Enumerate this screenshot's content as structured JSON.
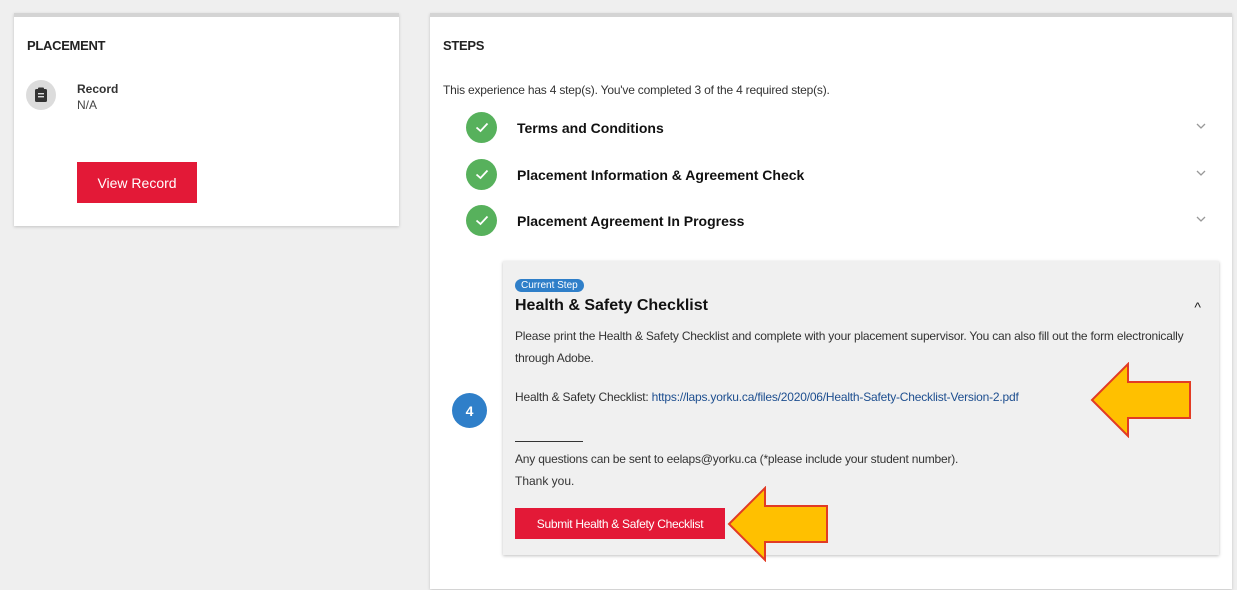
{
  "placement": {
    "title": "PLACEMENT",
    "record_label": "Record",
    "record_value": "N/A",
    "view_record_button": "View Record"
  },
  "steps": {
    "title": "STEPS",
    "summary": "This experience has 4 step(s). You've completed 3 of the 4 required step(s).",
    "completed": [
      {
        "label": "Terms and Conditions"
      },
      {
        "label": "Placement Information & Agreement Check"
      },
      {
        "label": "Placement Agreement In Progress"
      }
    ],
    "current": {
      "number": "4",
      "badge": "Current Step",
      "title": "Health & Safety Checklist",
      "caret": "^",
      "description": "Please print the Health & Safety Checklist and complete with your placement supervisor. You can also fill out the form electronically through Adobe.",
      "link_prefix": "Health & Safety Checklist: ",
      "link_text": "https://laps.yorku.ca/files/2020/06/Health-Safety-Checklist-Version-2.pdf",
      "questions": "Any questions can be sent to eelaps@yorku.ca (*please include your student number).",
      "thanks": "Thank you.",
      "submit_button": "Submit Health & Safety Checklist"
    }
  },
  "colors": {
    "accent_red": "#e31937",
    "check_green": "#57b15c",
    "step_blue": "#2f7fc9",
    "arrow_fill": "#ffc000",
    "arrow_stroke": "#e23b24"
  },
  "icons": {
    "record": "clipboard-icon",
    "complete": "check-icon",
    "expand": "chevron-down-icon",
    "annotation": "arrow-left-icon"
  }
}
